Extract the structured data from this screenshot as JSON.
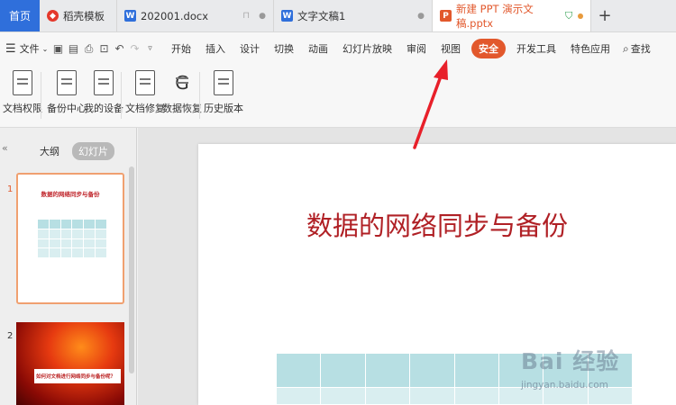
{
  "tabs": {
    "home": "首页",
    "items": [
      {
        "label": "稻壳模板",
        "icon": "daoke-icon"
      },
      {
        "label": "202001.docx",
        "icon": "word-doc-icon"
      },
      {
        "label": "文字文稿1",
        "icon": "word-doc-icon"
      },
      {
        "label": "新建 PPT 演示文稿.pptx",
        "icon": "ppt-icon",
        "active": true
      }
    ],
    "add": "+"
  },
  "menubar": {
    "file": "文件",
    "items": [
      "开始",
      "插入",
      "设计",
      "切换",
      "动画",
      "幻灯片放映",
      "审阅",
      "视图",
      "安全",
      "开发工具",
      "特色应用"
    ],
    "active": "安全",
    "search": "查找",
    "accent_color": "#e2582c"
  },
  "ribbon": {
    "buttons": [
      "文档权限",
      "备份中心",
      "我的设备",
      "文档修复",
      "数据恢复",
      "历史版本"
    ]
  },
  "side_panel": {
    "collapse": "«",
    "tab_outline": "大纲",
    "tab_slides": "幻灯片",
    "slides": [
      {
        "num": "1",
        "title": "数据的网络同步与备份"
      },
      {
        "num": "2",
        "title": "如何对文档进行网络同步与备份呢？"
      }
    ]
  },
  "slide": {
    "title": "数据的网络同步与备份",
    "title_color": "#b02025",
    "table_color": "#d9eef0"
  },
  "watermark": {
    "main": "Bai 经验",
    "sub": "jingyan.baidu.com"
  }
}
